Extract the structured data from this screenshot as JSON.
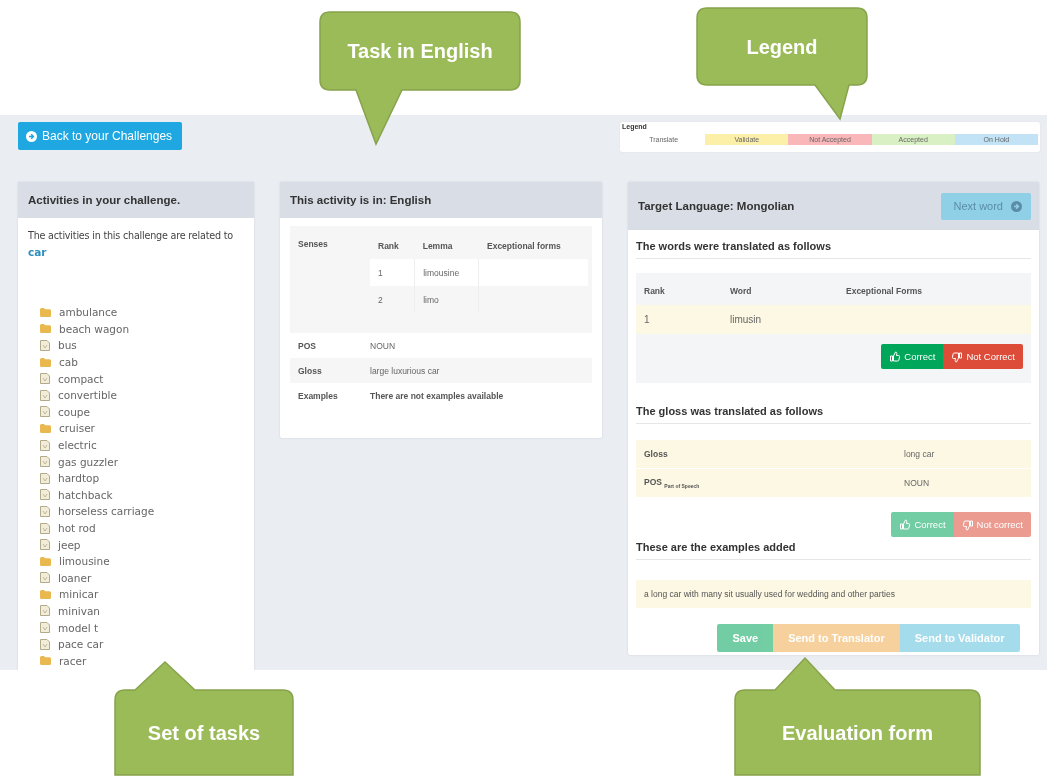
{
  "back_button": {
    "label": "Back to your Challenges"
  },
  "legend": {
    "title": "Legend",
    "items": [
      {
        "label": "Translate",
        "color": "#ffffff"
      },
      {
        "label": "Validate",
        "color": "#fcefa8"
      },
      {
        "label": "Not Accepted",
        "color": "#f9b7b9"
      },
      {
        "label": "Accepted",
        "color": "#d9efc4"
      },
      {
        "label": "On Hold",
        "color": "#c2e2f5"
      }
    ]
  },
  "activities_panel": {
    "title": "Activities in your challenge.",
    "intro": "The activities in this challenge are related to",
    "topic": "car",
    "items": [
      {
        "label": "ambulance",
        "kind": "folder"
      },
      {
        "label": "beach wagon",
        "kind": "folder"
      },
      {
        "label": "bus",
        "kind": "file"
      },
      {
        "label": "cab",
        "kind": "folder"
      },
      {
        "label": "compact",
        "kind": "file"
      },
      {
        "label": "convertible",
        "kind": "file"
      },
      {
        "label": "coupe",
        "kind": "file"
      },
      {
        "label": "cruiser",
        "kind": "folder"
      },
      {
        "label": "electric",
        "kind": "file"
      },
      {
        "label": "gas guzzler",
        "kind": "file"
      },
      {
        "label": "hardtop",
        "kind": "file"
      },
      {
        "label": "hatchback",
        "kind": "file"
      },
      {
        "label": "horseless carriage",
        "kind": "file"
      },
      {
        "label": "hot rod",
        "kind": "file"
      },
      {
        "label": "jeep",
        "kind": "file"
      },
      {
        "label": "limousine",
        "kind": "folder"
      },
      {
        "label": "loaner",
        "kind": "file"
      },
      {
        "label": "minicar",
        "kind": "folder"
      },
      {
        "label": "minivan",
        "kind": "file"
      },
      {
        "label": "model t",
        "kind": "file"
      },
      {
        "label": "pace car",
        "kind": "file"
      },
      {
        "label": "racer",
        "kind": "folder"
      }
    ]
  },
  "activity_panel": {
    "title": "This activity is in: English",
    "senses_label": "Senses",
    "senses_columns": [
      "Rank",
      "Lemma",
      "Exceptional forms"
    ],
    "senses": [
      {
        "rank": "1",
        "lemma": "limousine"
      },
      {
        "rank": "2",
        "lemma": "limo"
      }
    ],
    "fields": [
      {
        "label": "POS",
        "value": "NOUN",
        "kind": "plain"
      },
      {
        "label": "Gloss",
        "value": "large luxurious car",
        "kind": "plain"
      },
      {
        "label": "Examples",
        "value": "There are not examples available",
        "kind": "notice"
      }
    ]
  },
  "target_panel": {
    "title": "Target Language: Mongolian",
    "next_button": {
      "label": "Next word",
      "disabled": true
    },
    "words_heading": "The words were translated as follows",
    "words_columns": [
      "Rank",
      "Word",
      "Exceptional Forms"
    ],
    "words": [
      {
        "rank": "1",
        "word": "limusin"
      }
    ],
    "words_buttons": [
      {
        "label": "Correct",
        "kind": "success",
        "disabled": false
      },
      {
        "label": "Not Correct",
        "kind": "danger",
        "disabled": false
      }
    ],
    "gloss_heading": "The gloss was translated as follows",
    "gloss_rows": [
      {
        "label": "Gloss",
        "value": "long car"
      },
      {
        "label": "POS $_{Part of Speech}$",
        "value": "NOUN"
      }
    ],
    "gloss_buttons": [
      {
        "label": "Correct",
        "kind": "success",
        "disabled": true
      },
      {
        "label": "Not correct",
        "kind": "danger",
        "disabled": true
      }
    ],
    "examples_heading": "These are the examples added",
    "examples": [
      "a long car with many sit usually used for wedding and other parties"
    ],
    "actions": [
      {
        "label": "Save",
        "kind": "success",
        "disabled": true
      },
      {
        "label": "Send to Translator",
        "kind": "warning",
        "disabled": true
      },
      {
        "label": "Send to Validator",
        "kind": "info",
        "disabled": true
      }
    ]
  },
  "callouts": [
    {
      "label": "Task in English"
    },
    {
      "label": "Legend"
    },
    {
      "label": "Set of tasks"
    },
    {
      "label": "Evaluation form"
    }
  ]
}
